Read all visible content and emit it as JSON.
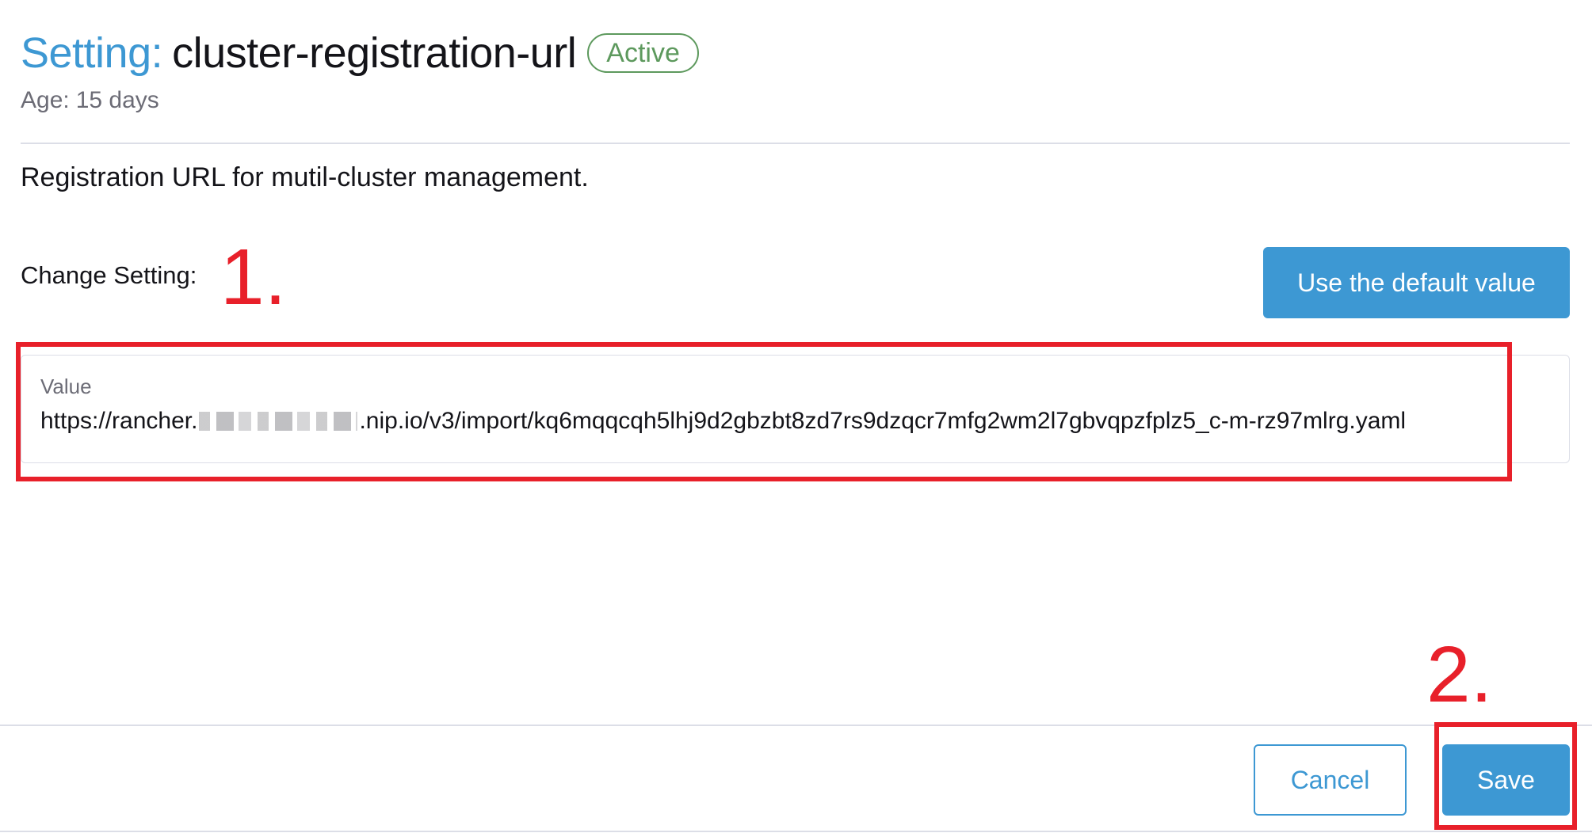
{
  "header": {
    "title_prefix": "Setting:",
    "title_name": "cluster-registration-url",
    "status": "Active",
    "age_label": "Age:",
    "age_value": "15 days"
  },
  "description": "Registration URL for mutil-cluster management.",
  "change_setting": {
    "label": "Change Setting:",
    "default_button_label": "Use the default value"
  },
  "value_field": {
    "label": "Value",
    "value_prefix": "https://rancher.",
    "value_suffix": ".nip.io/v3/import/kq6mqqcqh5lhj9d2gbzbt8zd7rs9dzqcr7mfg2wm2l7gbvqpzfplz5_c-m-rz97mlrg.yaml"
  },
  "annotations": {
    "step_1": "1.",
    "step_2": "2."
  },
  "footer": {
    "cancel_label": "Cancel",
    "save_label": "Save"
  },
  "colors": {
    "accent": "#3d98d3",
    "status_active": "#5d995d",
    "annotation_red": "#e8202a",
    "text_primary": "#141419",
    "text_muted": "#6c6c76"
  }
}
